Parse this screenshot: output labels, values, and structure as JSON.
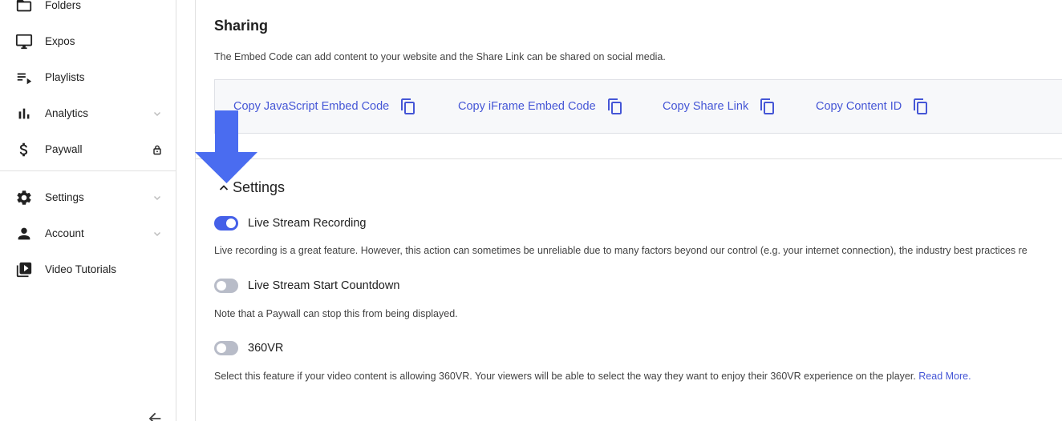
{
  "sidebar": {
    "items": [
      {
        "label": "Folders",
        "icon": "folder-icon"
      },
      {
        "label": "Expos",
        "icon": "monitor-icon"
      },
      {
        "label": "Playlists",
        "icon": "playlist-icon"
      },
      {
        "label": "Analytics",
        "icon": "bar-chart-icon"
      },
      {
        "label": "Paywall",
        "icon": "dollar-icon"
      },
      {
        "label": "Settings",
        "icon": "gear-icon"
      },
      {
        "label": "Account",
        "icon": "person-icon"
      },
      {
        "label": "Video Tutorials",
        "icon": "video-library-icon"
      }
    ]
  },
  "sharing": {
    "title": "Sharing",
    "description": "The Embed Code can add content to your website and the Share Link can be shared on social media.",
    "links": [
      {
        "label": "Copy JavaScript Embed Code"
      },
      {
        "label": "Copy iFrame Embed Code"
      },
      {
        "label": "Copy Share Link"
      },
      {
        "label": "Copy Content ID"
      }
    ]
  },
  "settings": {
    "title": "Settings",
    "options": [
      {
        "label": "Live Stream Recording",
        "enabled": true,
        "description": "Live recording is a great feature. However, this action can sometimes be unreliable due to many factors beyond our control (e.g. your internet connection), the industry best practices re"
      },
      {
        "label": "Live Stream Start Countdown",
        "enabled": false,
        "description": "Note that a Paywall can stop this from being displayed."
      },
      {
        "label": "360VR",
        "enabled": false,
        "description": "Select this feature if your video content is allowing 360VR. Your viewers will be able to select the way they want to enjoy their 360VR experience on the player. ",
        "link_label": "Read More."
      }
    ]
  },
  "colors": {
    "accent": "#4556d6",
    "toggle_on": "#4560e8",
    "toggle_off": "#b8bcc8",
    "annotation_arrow": "#4a6cf0"
  }
}
